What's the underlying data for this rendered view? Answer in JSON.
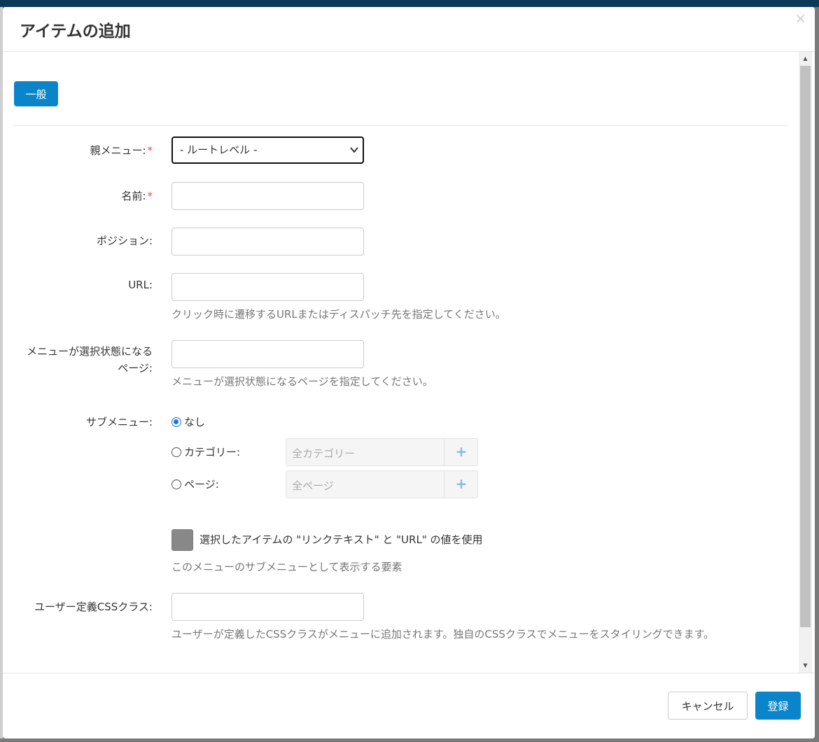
{
  "dialog": {
    "title": "アイテムの追加",
    "close_glyph": "×"
  },
  "tabs": [
    {
      "label": "一般",
      "active": true
    }
  ],
  "form": {
    "parent_menu": {
      "label": "親メニュー:",
      "required_mark": "*",
      "selected": "- ルートレベル -"
    },
    "name": {
      "label": "名前:",
      "required_mark": "*",
      "value": ""
    },
    "position": {
      "label": "ポジション:",
      "value": ""
    },
    "url": {
      "label": "URL:",
      "value": "",
      "help": "クリック時に遷移するURLまたはディスパッチ先を指定してください。"
    },
    "selected_page": {
      "label_line1": "メニューが選択状態になる",
      "label_line2": "ページ:",
      "value": "",
      "help": "メニューが選択状態になるページを指定してください。"
    },
    "submenu": {
      "label": "サブメニュー:",
      "options": [
        {
          "label": "なし",
          "checked": true
        },
        {
          "label": "カテゴリー:",
          "checked": false,
          "picker_placeholder": "全カテゴリー",
          "add_glyph": "+"
        },
        {
          "label": "ページ:",
          "checked": false,
          "picker_placeholder": "全ページ",
          "add_glyph": "+"
        }
      ],
      "use_values_label": "選択したアイテムの \"リンクテキスト\" と \"URL\" の値を使用",
      "help": "このメニューのサブメニューとして表示する要素"
    },
    "css_class": {
      "label": "ユーザー定義CSSクラス:",
      "value": "",
      "help": "ユーザーが定義したCSSクラスがメニューに追加されます。独自のCSSクラスでメニューをスタイリングできます。"
    }
  },
  "footer": {
    "cancel_label": "キャンセル",
    "submit_label": "登録"
  },
  "colors": {
    "primary": "#0a85c9",
    "required": "#d9534f",
    "help_text": "#777777"
  }
}
